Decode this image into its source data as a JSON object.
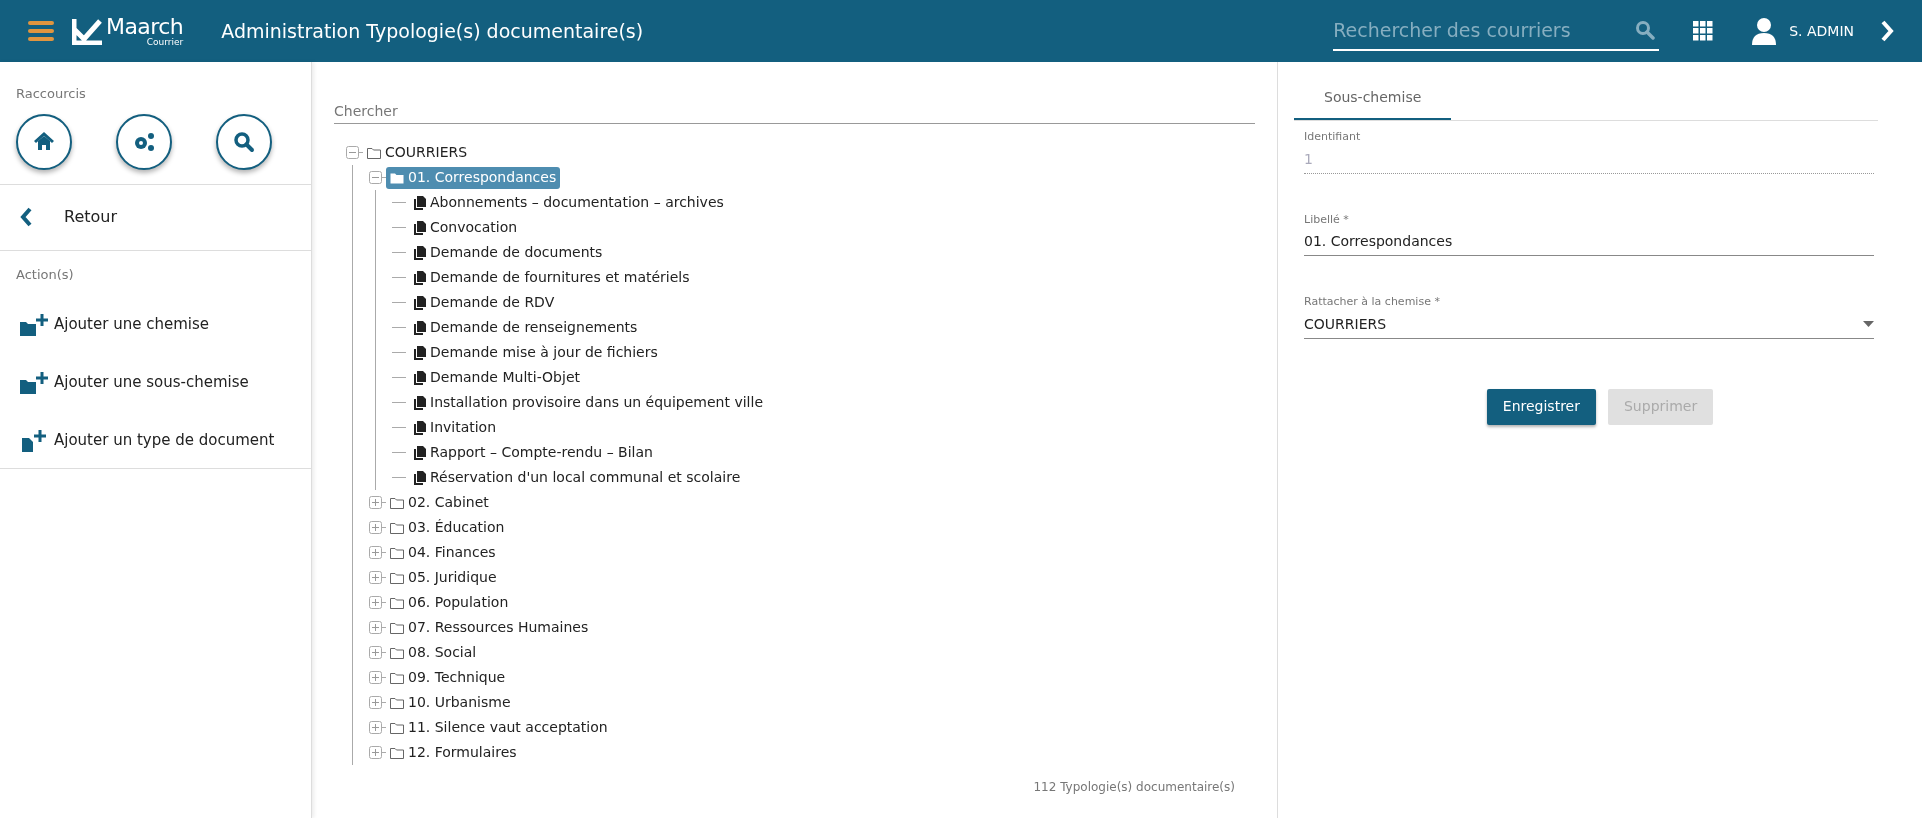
{
  "header": {
    "logo": {
      "name": "Maarch",
      "sub": "Courrier"
    },
    "title": "Administration Typologie(s) documentaire(s)",
    "search": {
      "placeholder": "Rechercher des courriers"
    },
    "user": "S. ADMIN"
  },
  "sidebar": {
    "shortcuts_title": "Raccourcis",
    "shortcuts": [
      {
        "kind": "home"
      },
      {
        "kind": "admin"
      },
      {
        "kind": "search"
      }
    ],
    "back": "Retour",
    "actions_title": "Action(s)",
    "actions": [
      {
        "kind": "folder",
        "label": "Ajouter une chemise"
      },
      {
        "kind": "folder",
        "label": "Ajouter une sous-chemise"
      },
      {
        "kind": "doctype",
        "label": "Ajouter un type de document"
      }
    ]
  },
  "tree": {
    "search": {
      "placeholder": "Chercher"
    },
    "nodes": [
      {
        "kind": "folder",
        "label": "COURRIERS",
        "expanded": true,
        "selected": false,
        "children": [
          {
            "kind": "folder",
            "label": "01. Correspondances",
            "expanded": true,
            "selected": true,
            "children": [
              {
                "kind": "doctype",
                "label": "Abonnements – documentation – archives",
                "selected": false
              },
              {
                "kind": "doctype",
                "label": "Convocation",
                "selected": false
              },
              {
                "kind": "doctype",
                "label": "Demande de documents",
                "selected": false
              },
              {
                "kind": "doctype",
                "label": "Demande de fournitures et matériels",
                "selected": false
              },
              {
                "kind": "doctype",
                "label": "Demande de RDV",
                "selected": false
              },
              {
                "kind": "doctype",
                "label": "Demande de renseignements",
                "selected": false
              },
              {
                "kind": "doctype",
                "label": "Demande mise à jour de fichiers",
                "selected": false
              },
              {
                "kind": "doctype",
                "label": "Demande Multi-Objet",
                "selected": false
              },
              {
                "kind": "doctype",
                "label": "Installation provisoire dans un équipement ville",
                "selected": false
              },
              {
                "kind": "doctype",
                "label": "Invitation",
                "selected": false
              },
              {
                "kind": "doctype",
                "label": "Rapport – Compte-rendu – Bilan",
                "selected": false
              },
              {
                "kind": "doctype",
                "label": "Réservation d'un local communal et scolaire",
                "selected": false
              }
            ]
          },
          {
            "kind": "folder",
            "label": "02. Cabinet",
            "expanded": false,
            "selected": false
          },
          {
            "kind": "folder",
            "label": "03. Éducation",
            "expanded": false,
            "selected": false
          },
          {
            "kind": "folder",
            "label": "04. Finances",
            "expanded": false,
            "selected": false
          },
          {
            "kind": "folder",
            "label": "05. Juridique",
            "expanded": false,
            "selected": false
          },
          {
            "kind": "folder",
            "label": "06. Population",
            "expanded": false,
            "selected": false
          },
          {
            "kind": "folder",
            "label": "07. Ressources Humaines",
            "expanded": false,
            "selected": false
          },
          {
            "kind": "folder",
            "label": "08. Social",
            "expanded": false,
            "selected": false
          },
          {
            "kind": "folder",
            "label": "09. Technique",
            "expanded": false,
            "selected": false
          },
          {
            "kind": "folder",
            "label": "10. Urbanisme",
            "expanded": false,
            "selected": false
          },
          {
            "kind": "folder",
            "label": "11. Silence vaut acceptation",
            "expanded": false,
            "selected": false
          },
          {
            "kind": "folder",
            "label": "12. Formulaires",
            "expanded": false,
            "selected": false
          }
        ]
      }
    ],
    "count": "112 Typologie(s) documentaire(s)"
  },
  "form": {
    "tabs": [
      {
        "label": "Sous-chemise",
        "selected": true
      }
    ],
    "fields": [
      {
        "kind": "readonly",
        "label": "Identifiant",
        "value": "1"
      },
      {
        "kind": "text",
        "label": "Libellé *",
        "value": "01. Correspondances"
      },
      {
        "kind": "select",
        "label": "Rattacher à la chemise *",
        "value": "COURRIERS"
      }
    ],
    "buttons": [
      {
        "label": "Enregistrer",
        "disabled": false
      },
      {
        "label": "Supprimer",
        "disabled": true
      }
    ]
  }
}
